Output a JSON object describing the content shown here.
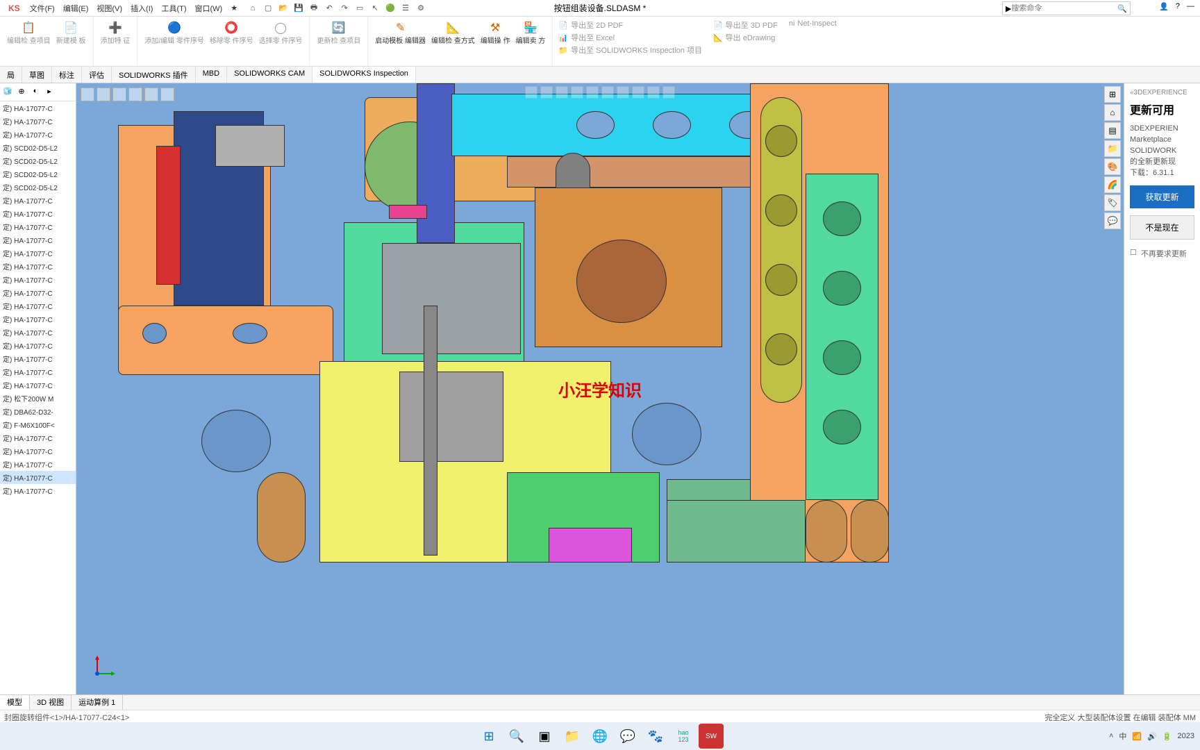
{
  "app": {
    "logo": "KS",
    "doc_title": "按钮组装设备.SLDASM *"
  },
  "menu": [
    "文件(F)",
    "编辑(E)",
    "视图(V)",
    "插入(I)",
    "工具(T)",
    "窗口(W)"
  ],
  "search": {
    "placeholder": "搜索命令"
  },
  "ribbon": {
    "g1": [
      {
        "label": "编辑检\n查项目"
      },
      {
        "label": "新建模\n板"
      }
    ],
    "g2": [
      {
        "label": "添加特\n征"
      }
    ],
    "g3": [
      {
        "label": "添加/编辑\n零件序号"
      },
      {
        "label": "移除零\n件序号"
      },
      {
        "label": "选择零\n件序号"
      }
    ],
    "g4": [
      {
        "label": "更新检\n查项目"
      }
    ],
    "g5": [
      {
        "label": "启动模板\n编辑器"
      },
      {
        "label": "编辑检\n查方式"
      },
      {
        "label": "编辑操\n作"
      },
      {
        "label": "编辑卖\n方"
      }
    ],
    "exports": [
      [
        "导出至 2D PDF",
        "导出至 Excel",
        "导出至 SOLIDWORKS Inspection 项目"
      ],
      [
        "导出至 3D PDF",
        "导出 eDrawing"
      ],
      [
        "Net-Inspect"
      ]
    ]
  },
  "tabs": [
    "局",
    "草图",
    "标注",
    "评估",
    "SOLIDWORKS 插件",
    "MBD",
    "SOLIDWORKS CAM",
    "SOLIDWORKS Inspection"
  ],
  "tree": [
    "定) HA-17077-C",
    "定) HA-17077-C",
    "定) HA-17077-C",
    "定) SCD02-D5-L2",
    "定) SCD02-D5-L2",
    "定) SCD02-D5-L2",
    "定) SCD02-D5-L2",
    "定) HA-17077-C",
    "定) HA-17077-C",
    "定) HA-17077-C",
    "定) HA-17077-C",
    "定) HA-17077-C",
    "定) HA-17077-C",
    "定) HA-17077-C",
    "定) HA-17077-C",
    "定) HA-17077-C",
    "定) HA-17077-C",
    "定) HA-17077-C",
    "定) HA-17077-C",
    "定) HA-17077-C",
    "定) HA-17077-C",
    "定) HA-17077-C",
    "定) 松下200W M",
    "定) DBA62-D32-",
    "定) F-M6X100F<",
    "定) HA-17077-C",
    "定) HA-17077-C",
    "定) HA-17077-C",
    "定) HA-17077-C",
    "定) HA-17077-C"
  ],
  "tree_selected": 28,
  "watermark": "小汪学知识",
  "rightpanel": {
    "header": "«3DEXPERIENCE",
    "title": "更新可用",
    "body1": "3DEXPERIEN",
    "body2": "Marketplace",
    "body3": "SOLIDWORK",
    "body4": "的全新更新现",
    "body5": "下载：6.31.1",
    "btn1": "获取更新",
    "btn2": "不是现在",
    "check": "不再要求更新"
  },
  "bottom_tabs": [
    "模型",
    "3D 视图",
    "运动算例 1"
  ],
  "breadcrumb": "封圈旋转组件<1>/HA-17077-C24<1>",
  "status_right": "完全定义   大型装配体设置   在编辑 装配体               MM",
  "systray": {
    "time": "2023",
    "ime": "中"
  }
}
